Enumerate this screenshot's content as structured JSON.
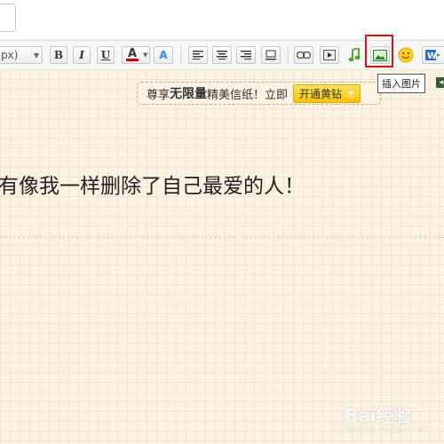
{
  "toolbar": {
    "font_size_value": "px)",
    "bold_label": "B",
    "italic_label": "I",
    "underline_label": "U",
    "font_color_label": "A",
    "font_bg_label": "A"
  },
  "tooltip": {
    "insert_image": "插入图片"
  },
  "promo": {
    "text_before": "尊享",
    "emphasis": "无限量",
    "text_after": "精美信纸！立即",
    "button_label": "开通黄钻"
  },
  "editor": {
    "content_text": "有像我一样删除了自己最爱的人！"
  },
  "watermark": {
    "text": "Bai经验",
    "sub": "jingyan.baidu.com"
  },
  "colors": {
    "highlight": "#e01010",
    "font_color_bar": "#d00000",
    "paper": "#fbf3e3",
    "promo_button": "#f7c20a"
  }
}
